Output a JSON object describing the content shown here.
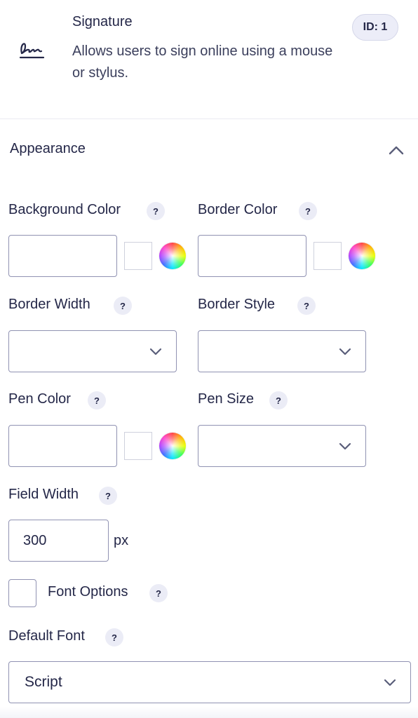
{
  "field": {
    "title": "Signature",
    "description": "Allows users to sign online using a mouse or stylus.",
    "id_badge": "ID: 1"
  },
  "section": {
    "title": "Appearance"
  },
  "settings": {
    "background_color": {
      "label": "Background Color",
      "value": ""
    },
    "border_color": {
      "label": "Border Color",
      "value": ""
    },
    "border_width": {
      "label": "Border Width",
      "selected": ""
    },
    "border_style": {
      "label": "Border Style",
      "selected": ""
    },
    "pen_color": {
      "label": "Pen Color",
      "value": ""
    },
    "pen_size": {
      "label": "Pen Size",
      "selected": ""
    },
    "field_width": {
      "label": "Field Width",
      "value": "300",
      "unit": "px"
    },
    "font_options": {
      "label": "Font Options",
      "checked": false
    },
    "default_font": {
      "label": "Default Font",
      "selected": "Script"
    }
  },
  "help_glyph": "?",
  "icons": {
    "field": "signature-icon",
    "collapse": "chevron-up-icon",
    "dropdown": "chevron-down-icon",
    "color_picker": "color-wheel-icon",
    "help": "help-icon"
  },
  "colors": {
    "text": "#242748",
    "border": "#9092b2",
    "badge_bg": "#ecedf8",
    "help_bg": "#ebecf6"
  }
}
